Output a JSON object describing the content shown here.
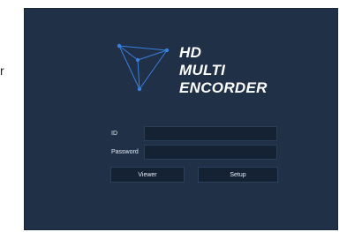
{
  "side_text": "r",
  "logo": {
    "line1": "HD",
    "line2": "MULTI",
    "line3": "ENCORDER"
  },
  "form": {
    "id_label": "ID",
    "id_value": "",
    "password_label": "Password",
    "password_value": ""
  },
  "buttons": {
    "viewer": "Viewer",
    "setup": "Setup"
  },
  "colors": {
    "panel_bg": "#1f3047",
    "field_bg": "#152233",
    "logo_blue": "#3a7fe0"
  }
}
